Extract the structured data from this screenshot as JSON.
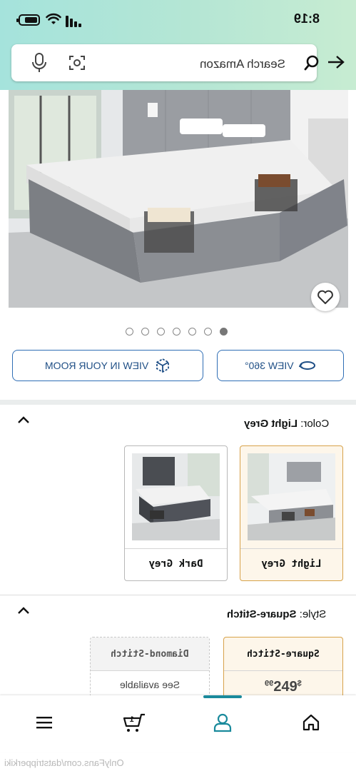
{
  "status": {
    "time": "8:19"
  },
  "search": {
    "placeholder": "Search Amazon"
  },
  "gallery": {
    "dot_count": 7,
    "active_dot": 6
  },
  "buttons": {
    "view_360": "VIEW 360°",
    "view_room": "VIEW IN YOUR ROOM"
  },
  "color": {
    "label": "Color:",
    "value": "Light Grey",
    "options": [
      {
        "name": "Light Grey",
        "selected": true
      },
      {
        "name": "Dark Grey",
        "selected": false
      }
    ]
  },
  "style": {
    "label": "Style:",
    "value": "Square-Stitch",
    "options": [
      {
        "name": "Square-Stitch",
        "price_symbol": "$",
        "price_whole": "249",
        "price_frac": "99",
        "selected": true
      },
      {
        "name": "Diamond-Stitch",
        "availability": "See available",
        "selected": false
      }
    ]
  },
  "watermark": "OnlyFans.com/datstripperkiki",
  "colors": {
    "accent": "#1a8a9c",
    "link": "#1f4f86",
    "selected_border": "#d7a24a"
  }
}
